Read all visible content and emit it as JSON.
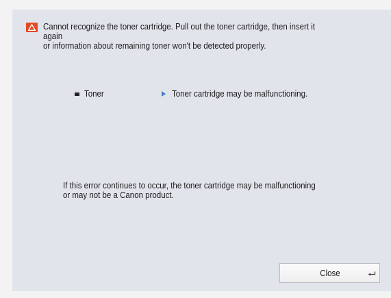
{
  "dialog": {
    "message": "Cannot recognize the toner cartridge. Pull out the toner cartridge, then insert it again\nor information about remaining toner won't be detected properly.",
    "warning_icon": "warning-triangle-icon",
    "warning_color": "#e34a25"
  },
  "status": {
    "item_icon": "toner-icon",
    "item_label": "Toner",
    "status_icon": "arrow-right-icon",
    "status_text": "Toner cartridge may be malfunctioning.",
    "arrow_color": "#3d7fc9"
  },
  "note": "If this error continues to occur, the toner cartridge may be malfunctioning\nor may not be a Canon product.",
  "buttons": {
    "close_label": "Close",
    "close_icon": "return-icon"
  }
}
